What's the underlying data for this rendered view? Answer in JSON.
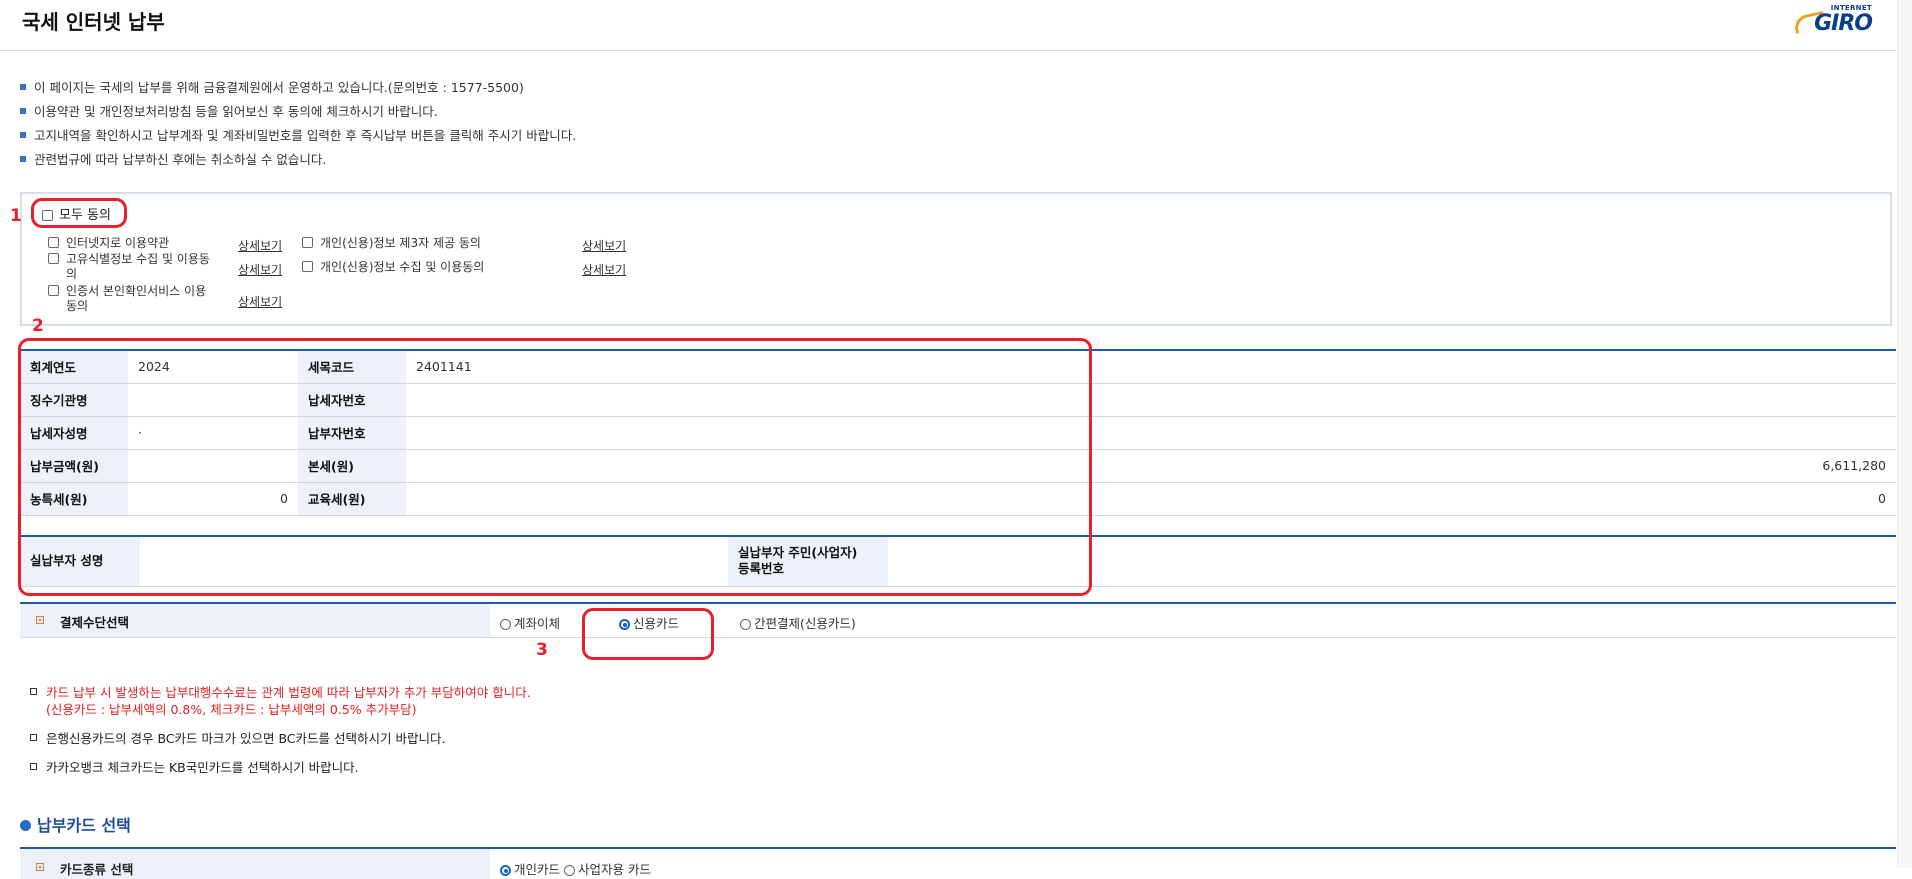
{
  "header": {
    "title": "국세 인터넷 납부",
    "logo_small": "INTERNET",
    "logo_big": "GIRO"
  },
  "notices": [
    "이 페이지는 국세의 납부를 위해 금융결제원에서 운영하고 있습니다.(문의번호 : 1577-5500)",
    "이용약관 및 개인정보처리방침 등을 읽어보신 후 동의에 체크하시기 바랍니다.",
    "고지내역을 확인하시고 납부계좌 및 계좌비밀번호를 입력한 후 즉시납부 버튼을 클릭해 주시기 바랍니다.",
    "관련법규에 따라 납부하신 후에는 취소하실 수 없습니다."
  ],
  "agreements": {
    "all_label": "모두 동의",
    "detail_label": "상세보기",
    "items": [
      "인터넷지로 이용약관",
      "고유식별정보 수집 및 이용동의",
      "인증서 본인확인서비스 이용동의",
      "개인(신용)정보 제3자 제공 동의",
      "개인(신용)정보 수집 및 이용동의"
    ]
  },
  "annotations": {
    "one": "1",
    "two": "2",
    "three": "3"
  },
  "tax_info": {
    "fiscal_year_label": "회계연도",
    "fiscal_year": "2024",
    "tax_code_label": "세목코드",
    "tax_code": "2401141",
    "agency_label": "징수기관명",
    "agency": "",
    "taxpayer_no_label": "납세자번호",
    "taxpayer_no": "",
    "taxpayer_name_label": "납세자성명",
    "taxpayer_name": "·",
    "payer_no_label": "납부자번호",
    "payer_no": "",
    "amount_label": "납부금액(원)",
    "amount": "",
    "main_tax_label": "본세(원)",
    "main_tax": "6,611,280",
    "rural_tax_label": "농특세(원)",
    "rural_tax": "0",
    "edu_tax_label": "교육세(원)",
    "edu_tax": "0"
  },
  "payer": {
    "name_label": "실납부자 성명",
    "name": "",
    "id_label_1": "실납부자 주민(사업자)",
    "id_label_2": "등록번호",
    "id": ""
  },
  "payment_method": {
    "label": "결제수단선택",
    "options": [
      "계좌이체",
      "신용카드",
      "간편결제(신용카드)"
    ],
    "selected": "신용카드"
  },
  "card_notes": {
    "fee_line1": "카드 납부 시 발생하는 납부대행수수료는 관계 법령에 따라 납부자가 추가 부담하여야 합니다.",
    "fee_line2": "(신용카드 : 납부세액의 0.8%, 체크카드 : 납부세액의 0.5% 추가부담)",
    "bc_note": "은행신용카드의 경우 BC카드 마크가 있으면 BC카드를 선택하시기 바랍니다.",
    "kakao_note": "카카오뱅크 체크카드는 KB국민카드를 선택하시기 바랍니다."
  },
  "card_select": {
    "section_title": "납부카드 선택",
    "type_label": "카드종류 선택",
    "options": [
      "개인카드",
      "사업자용 카드"
    ],
    "selected": "개인카드"
  },
  "colors": {
    "accent": "#1f5ba8",
    "header_bg": "#edf2fa",
    "annotation_red": "#e8202a",
    "warning_red": "#e02020"
  }
}
